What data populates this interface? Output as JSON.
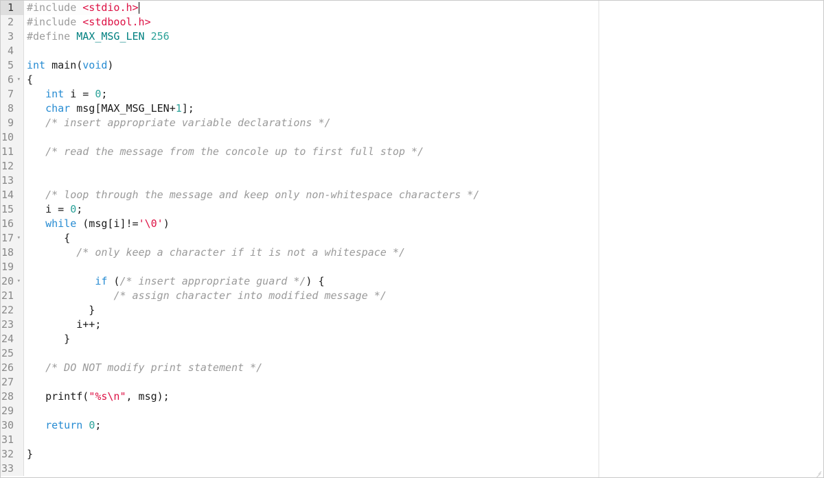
{
  "editor": {
    "active_line": 1,
    "fold_lines": [
      6,
      17,
      20
    ],
    "lines": [
      {
        "n": 1,
        "tokens": [
          {
            "t": "#include ",
            "c": "tok-include-kw"
          },
          {
            "t": "<stdio.h>",
            "c": "tok-header"
          }
        ],
        "cursor_after": true
      },
      {
        "n": 2,
        "tokens": [
          {
            "t": "#include ",
            "c": "tok-include-kw"
          },
          {
            "t": "<stdbool.h>",
            "c": "tok-header"
          }
        ]
      },
      {
        "n": 3,
        "tokens": [
          {
            "t": "#define ",
            "c": "tok-include-kw"
          },
          {
            "t": "MAX_MSG_LEN",
            "c": "tok-define-name"
          },
          {
            "t": " 256",
            "c": "tok-number"
          }
        ]
      },
      {
        "n": 4,
        "tokens": []
      },
      {
        "n": 5,
        "tokens": [
          {
            "t": "int",
            "c": "tok-type"
          },
          {
            "t": " main(",
            "c": "tok-ident"
          },
          {
            "t": "void",
            "c": "tok-type"
          },
          {
            "t": ")",
            "c": "tok-punct"
          }
        ]
      },
      {
        "n": 6,
        "tokens": [
          {
            "t": "{",
            "c": "tok-punct"
          }
        ]
      },
      {
        "n": 7,
        "tokens": [
          {
            "t": "   ",
            "c": ""
          },
          {
            "t": "int",
            "c": "tok-type"
          },
          {
            "t": " i = ",
            "c": "tok-ident"
          },
          {
            "t": "0",
            "c": "tok-number"
          },
          {
            "t": ";",
            "c": "tok-punct"
          }
        ]
      },
      {
        "n": 8,
        "tokens": [
          {
            "t": "   ",
            "c": ""
          },
          {
            "t": "char",
            "c": "tok-type"
          },
          {
            "t": " msg[MAX_MSG_LEN+",
            "c": "tok-ident"
          },
          {
            "t": "1",
            "c": "tok-number"
          },
          {
            "t": "];",
            "c": "tok-punct"
          }
        ]
      },
      {
        "n": 9,
        "tokens": [
          {
            "t": "   ",
            "c": ""
          },
          {
            "t": "/* insert appropriate variable declarations */",
            "c": "tok-comment"
          }
        ]
      },
      {
        "n": 10,
        "tokens": []
      },
      {
        "n": 11,
        "tokens": [
          {
            "t": "   ",
            "c": ""
          },
          {
            "t": "/* read the message from the concole up to first full stop */",
            "c": "tok-comment"
          }
        ]
      },
      {
        "n": 12,
        "tokens": []
      },
      {
        "n": 13,
        "tokens": []
      },
      {
        "n": 14,
        "tokens": [
          {
            "t": "   ",
            "c": ""
          },
          {
            "t": "/* loop through the message and keep only non-whitespace characters */",
            "c": "tok-comment"
          }
        ]
      },
      {
        "n": 15,
        "tokens": [
          {
            "t": "   i = ",
            "c": "tok-ident"
          },
          {
            "t": "0",
            "c": "tok-number"
          },
          {
            "t": ";",
            "c": "tok-punct"
          }
        ]
      },
      {
        "n": 16,
        "tokens": [
          {
            "t": "   ",
            "c": ""
          },
          {
            "t": "while",
            "c": "tok-keyword"
          },
          {
            "t": " (msg[i]!=",
            "c": "tok-ident"
          },
          {
            "t": "'\\0'",
            "c": "tok-char"
          },
          {
            "t": ")",
            "c": "tok-punct"
          }
        ]
      },
      {
        "n": 17,
        "tokens": [
          {
            "t": "      {",
            "c": "tok-punct"
          }
        ]
      },
      {
        "n": 18,
        "tokens": [
          {
            "t": "        ",
            "c": ""
          },
          {
            "t": "/* only keep a character if it is not a whitespace */",
            "c": "tok-comment"
          }
        ]
      },
      {
        "n": 19,
        "tokens": []
      },
      {
        "n": 20,
        "tokens": [
          {
            "t": "           ",
            "c": ""
          },
          {
            "t": "if",
            "c": "tok-keyword"
          },
          {
            "t": " (",
            "c": "tok-punct"
          },
          {
            "t": "/* insert appropriate guard */",
            "c": "tok-comment"
          },
          {
            "t": ") {",
            "c": "tok-punct"
          }
        ]
      },
      {
        "n": 21,
        "tokens": [
          {
            "t": "              ",
            "c": ""
          },
          {
            "t": "/* assign character into modified message */",
            "c": "tok-comment"
          }
        ]
      },
      {
        "n": 22,
        "tokens": [
          {
            "t": "          }",
            "c": "tok-punct"
          }
        ]
      },
      {
        "n": 23,
        "tokens": [
          {
            "t": "        i++;",
            "c": "tok-ident"
          }
        ]
      },
      {
        "n": 24,
        "tokens": [
          {
            "t": "      }",
            "c": "tok-punct"
          }
        ]
      },
      {
        "n": 25,
        "tokens": []
      },
      {
        "n": 26,
        "tokens": [
          {
            "t": "   ",
            "c": ""
          },
          {
            "t": "/* DO NOT modify print statement */",
            "c": "tok-comment"
          }
        ]
      },
      {
        "n": 27,
        "tokens": []
      },
      {
        "n": 28,
        "tokens": [
          {
            "t": "   printf(",
            "c": "tok-ident"
          },
          {
            "t": "\"%s\\n\"",
            "c": "tok-string"
          },
          {
            "t": ", msg);",
            "c": "tok-ident"
          }
        ]
      },
      {
        "n": 29,
        "tokens": []
      },
      {
        "n": 30,
        "tokens": [
          {
            "t": "   ",
            "c": ""
          },
          {
            "t": "return",
            "c": "tok-keyword"
          },
          {
            "t": " ",
            "c": ""
          },
          {
            "t": "0",
            "c": "tok-number"
          },
          {
            "t": ";",
            "c": "tok-punct"
          }
        ]
      },
      {
        "n": 31,
        "tokens": []
      },
      {
        "n": 32,
        "tokens": [
          {
            "t": "}",
            "c": "tok-punct"
          }
        ]
      },
      {
        "n": 33,
        "tokens": []
      }
    ]
  }
}
